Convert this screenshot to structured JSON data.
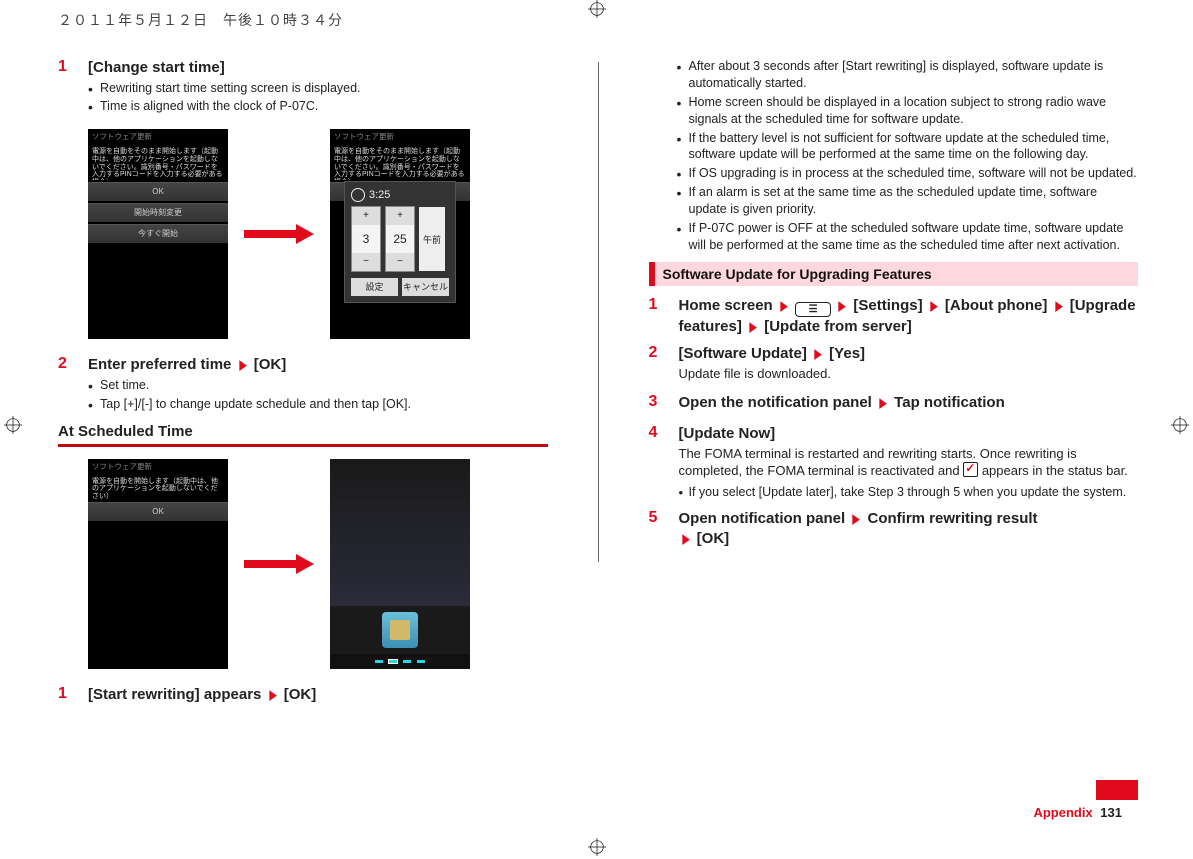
{
  "header": {
    "timestamp": "２０１１年５月１２日　午後１０時３４分"
  },
  "left": {
    "step1": {
      "num": "1",
      "title": "[Change start time]",
      "b1": "Rewriting start time setting screen is displayed.",
      "b2": "Time is aligned with the clock of P-07C."
    },
    "fig1": {
      "phoneA": {
        "hdr": "ソフトウェア更新",
        "line": "電源を自動をそのまま開始します（起動中は、他のアプリケーションを起動しないでください。識別番号・パスワードを入力するPINコードを入力する必要がある場合）",
        "btn1": "OK",
        "btn2": "開始時刻変更",
        "btn3": "今すぐ開始"
      },
      "phoneB": {
        "clock": "3:25",
        "h": "3",
        "m": "25",
        "ampm": "午前",
        "ok": "設定",
        "cancel": "キャンセル"
      }
    },
    "step2": {
      "num": "2",
      "title_a": "Enter preferred time ",
      "title_b": " [OK]",
      "b1": "Set time.",
      "b2": "Tap [+]/[-] to change update schedule and then tap [OK]."
    },
    "subhead": "At Scheduled Time",
    "fig2": {
      "phoneA": {
        "hdr": "ソフトウェア更新",
        "line": "電源を自動を開始します（起動中は、他のアプリケーションを起動しないでください）",
        "btn1": "OK"
      }
    },
    "step3": {
      "num": "1",
      "title_a": "[Start rewriting] appears ",
      "title_b": " [OK]"
    }
  },
  "right": {
    "bullets": {
      "b1": "After about 3 seconds after [Start rewriting] is displayed, software update is automatically started.",
      "b2": "Home screen should be displayed in a location subject to strong radio wave signals at the scheduled time for software update.",
      "b3": "If the battery level is not sufficient for software update at the scheduled time, software update will be performed at the same time on the following day.",
      "b4": "If OS upgrading is in process at the scheduled time, software will not be updated.",
      "b5": "If an alarm is set at the same time as the scheduled update time, software update is given priority.",
      "b6": "If P-07C power is OFF at the scheduled software update time, software update will be performed at the same time as the scheduled time after next activation."
    },
    "section": "Software Update for Upgrading Features",
    "s1": {
      "num": "1",
      "a": "Home screen ",
      "b": " [Settings] ",
      "c": " [About phone] ",
      "d": " [Upgrade features] ",
      "e": " [Update from server]"
    },
    "s2": {
      "num": "2",
      "a": "[Software Update] ",
      "b": " [Yes]",
      "sub": "Update file is downloaded."
    },
    "s3": {
      "num": "3",
      "a": "Open the notification panel ",
      "b": " Tap notification"
    },
    "s4": {
      "num": "4",
      "a": "[Update Now]",
      "sub1": "The FOMA terminal is restarted and rewriting starts. Once rewriting is completed, the FOMA terminal is reactivated and ",
      "sub1b": " appears in the status bar.",
      "bul": "If you select [Update later], take Step 3 through 5 when you update the system."
    },
    "s5": {
      "num": "5",
      "a": "Open notification panel ",
      "b": " Confirm rewriting result ",
      "c": " [OK]"
    }
  },
  "footer": {
    "section": "Appendix",
    "page": "131"
  }
}
